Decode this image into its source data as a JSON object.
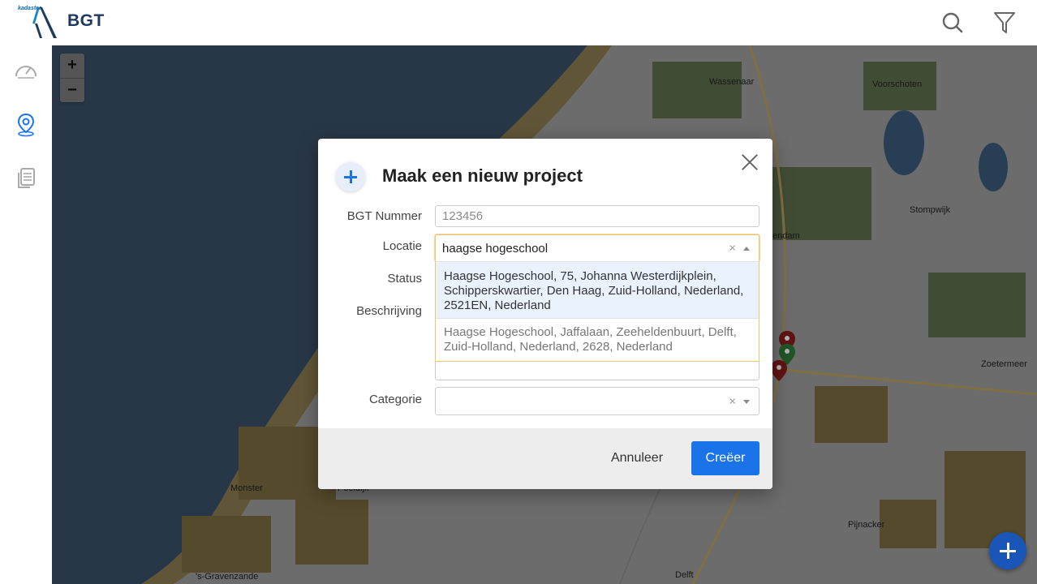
{
  "header": {
    "brand_small": "kadaster",
    "app_title": "BGT",
    "icons": [
      "search-icon",
      "filter-icon"
    ]
  },
  "sidebar": {
    "items": [
      {
        "icon": "dashboard-gauge-icon",
        "active": false
      },
      {
        "icon": "map-pin-icon",
        "active": true
      },
      {
        "icon": "documents-icon",
        "active": false
      }
    ]
  },
  "map": {
    "zoom_in": "+",
    "zoom_out": "−",
    "labels": [
      "Wassenaar",
      "Voorschoten",
      "Stompwijk",
      "endam",
      "Zoetermeer",
      "Monster",
      "Poeldijk",
      "Pijnacker",
      "'s-Gravenzande",
      "Delft"
    ]
  },
  "modal": {
    "title": "Maak een nieuw project",
    "fields": {
      "bgt_label": "BGT Nummer",
      "bgt_placeholder": "123456",
      "locatie_label": "Locatie",
      "locatie_value": "haagse hogeschool",
      "status_label": "Status",
      "beschrijving_label": "Beschrijving",
      "categorie_label": "Categorie",
      "clear_symbol": "×"
    },
    "suggestions": [
      "Haagse Hogeschool, 75, Johanna Westerdijkplein, Schipperskwartier, Den Haag, Zuid-Holland, Nederland, 2521EN, Nederland",
      "Haagse Hogeschool, Jaffalaan, Zeeheldenbuurt, Delft, Zuid-Holland, Nederland, 2628, Nederland"
    ],
    "cancel_label": "Annuleer",
    "create_label": "Creëer"
  },
  "colors": {
    "primary": "#1a73e8",
    "brand_navy": "#1e3a5f",
    "fab": "#1a56b8",
    "sea": "#6d8db4"
  }
}
